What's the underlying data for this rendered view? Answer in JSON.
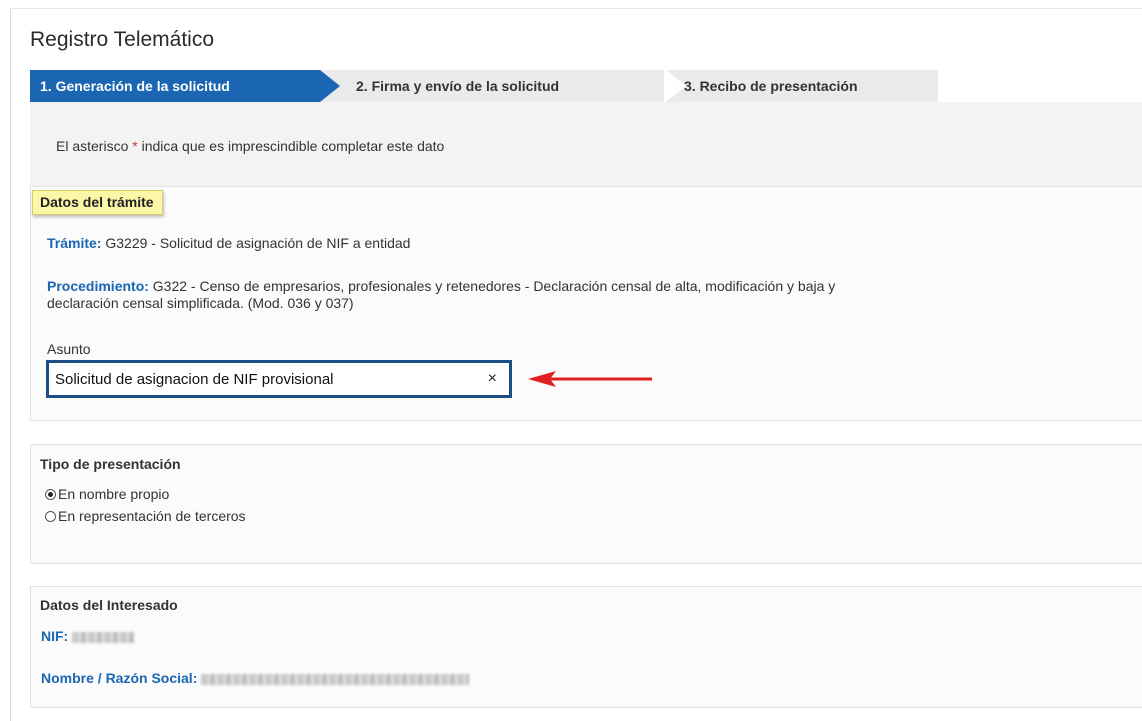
{
  "app": {
    "title": "Registro Telemático"
  },
  "steps": [
    {
      "label": "1. Generación de la solicitud",
      "active": true
    },
    {
      "label": "2. Firma y envío de la solicitud",
      "active": false
    },
    {
      "label": "3. Recibo de presentación",
      "active": false
    }
  ],
  "hint": {
    "before": "El asterisco ",
    "asterisk": "*",
    "after": " indica que es imprescindible completar este dato"
  },
  "tramite_section": {
    "tag": "Datos del trámite",
    "tramite_label": "Trámite:",
    "tramite_value": " G3229 - Solicitud de asignación de NIF a entidad",
    "procedimiento_label": "Procedimiento:",
    "procedimiento_value_line1": " G322 - Censo de empresarios, profesionales y retenedores - Declaración censal de alta, modificación y baja y",
    "procedimiento_value_line2": "declaración censal simplificada. (Mod. 036 y 037)",
    "asunto_label": "Asunto",
    "asunto_value": "Solicitud de asignacion de NIF provisional",
    "clear_icon": "×"
  },
  "presentacion": {
    "title": "Tipo de presentación",
    "options": [
      {
        "label": "En nombre propio",
        "checked": true
      },
      {
        "label": "En representación de terceros",
        "checked": false
      }
    ]
  },
  "interesado": {
    "title": "Datos del Interesado",
    "nif_label": "NIF:",
    "nombre_label": "Nombre / Razón Social:"
  },
  "colors": {
    "accent": "#1a66b3",
    "arrow": "#e02020",
    "tag_bg": "#fbf6a8"
  }
}
